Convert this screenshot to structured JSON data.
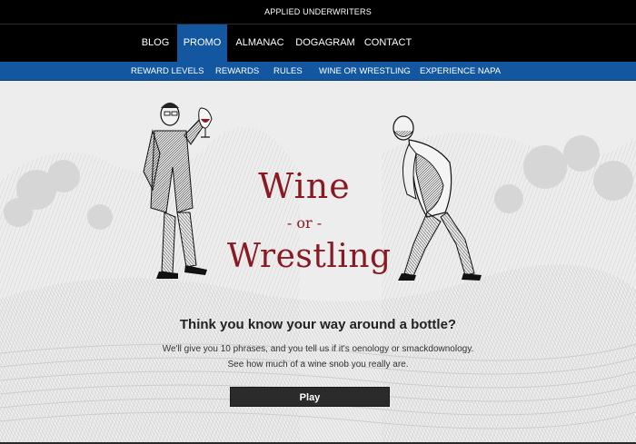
{
  "site": {
    "brand": "APPLIED UNDERWRITERS"
  },
  "main_nav": [
    "BLOG",
    "PROMO",
    "ALMANAC",
    "DOGAGRAM",
    "CONTACT"
  ],
  "active_main": "PROMO",
  "sub_nav": [
    "REWARD LEVELS",
    "REWARDS",
    "RULES",
    "WINE OR WRESTLING",
    "EXPERIENCE NAPA"
  ],
  "hero": {
    "title_top": "Wine",
    "title_mid": "- or -",
    "title_bottom": "Wrestling",
    "headline": "Think you know your way around a bottle?",
    "desc_line1": "We'll give you 10 phrases, and you tell us if it's oenology or smackdownology.",
    "desc_line2": "See how much of a wine snob you really are.",
    "play_label": "Play"
  },
  "colors": {
    "nav_bg": "#000000",
    "accent_blue": "#1457a1",
    "title_red": "#8a1a22",
    "button_bg": "#2b2b2b"
  }
}
